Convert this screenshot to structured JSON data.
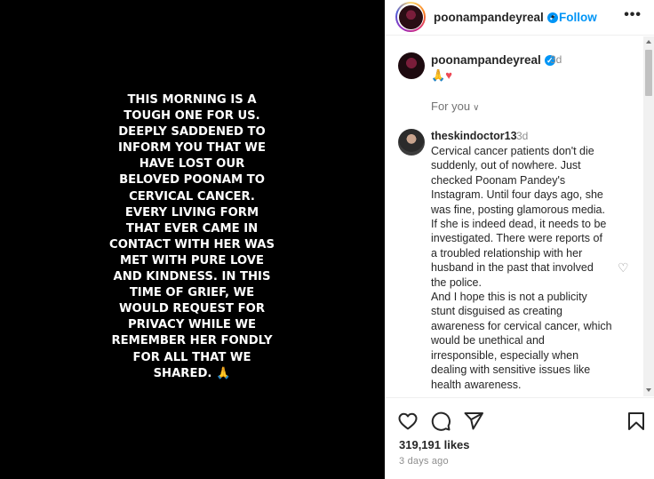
{
  "story": {
    "lines": [
      "THIS MORNING IS A",
      "TOUGH ONE FOR US.",
      "DEEPLY SADDENED TO",
      "INFORM YOU THAT WE",
      "HAVE LOST OUR",
      "BELOVED POONAM TO",
      "CERVICAL CANCER.",
      "EVERY LIVING FORM",
      "THAT EVER CAME IN",
      "CONTACT WITH HER WAS",
      "MET WITH PURE LOVE",
      "AND KINDNESS. IN THIS",
      "TIME OF GRIEF, WE",
      "WOULD REQUEST FOR",
      "PRIVACY WHILE WE",
      "REMEMBER HER FONDLY",
      "FOR ALL THAT WE",
      "SHARED. 🙏"
    ]
  },
  "header": {
    "username": "poonampandeyreal",
    "verified": "✓",
    "dot": "•",
    "follow_label": "Follow",
    "more": "•••"
  },
  "caption": {
    "username": "poonampandeyreal",
    "verified": "✓",
    "time": "3d",
    "text_prayer": "🙏",
    "text_heart": "♥"
  },
  "for_you": {
    "label": "For you",
    "chevron": "∨"
  },
  "comment": {
    "username": "theskindoctor13",
    "time": "3d",
    "lines": [
      "Cervical cancer patients don't die",
      "suddenly, out of nowhere. Just",
      "checked Poonam Pandey's",
      "Instagram. Until four days ago, she",
      "was fine, posting glamorous media.",
      "If she is indeed dead, it needs to be",
      "investigated. There were reports of",
      "a troubled relationship with her",
      "husband in the past that involved",
      "the police.",
      "And I hope this is not a publicity",
      "stunt disguised as creating",
      "awareness for cervical cancer, which",
      "would be unethical and",
      "irresponsible, especially when",
      "dealing with sensitive issues like",
      "health awareness."
    ],
    "like_icon": "♡"
  },
  "footer": {
    "likes": "319,191 likes",
    "time_ago": "3 days ago"
  },
  "icons": {
    "like": "heart-icon",
    "comment": "comment-icon",
    "share": "share-icon",
    "save": "bookmark-icon"
  },
  "colors": {
    "accent": "#0095f6",
    "heart": "#ed4956",
    "muted": "#8e8e8e"
  }
}
